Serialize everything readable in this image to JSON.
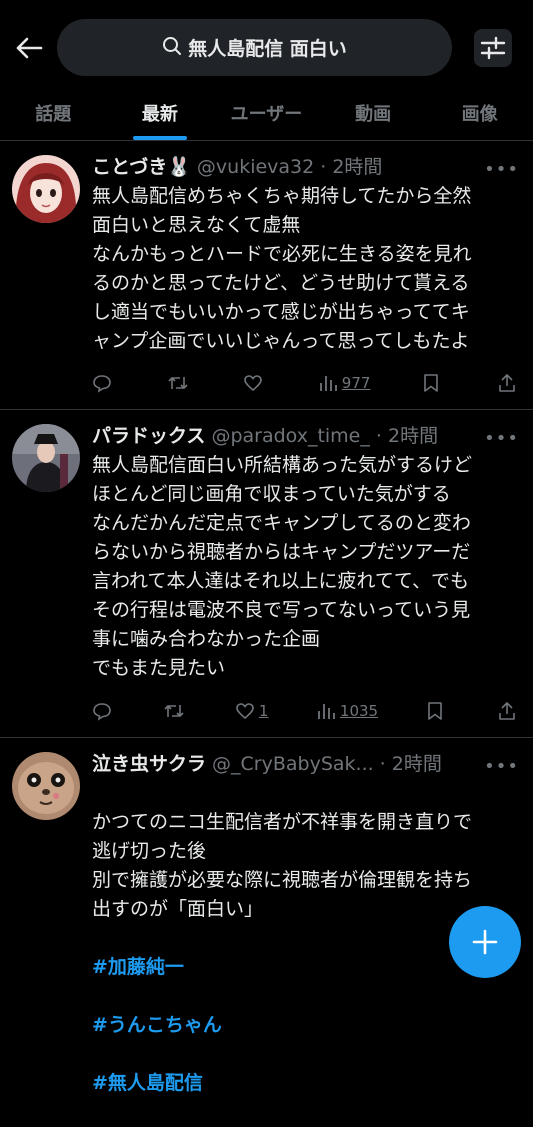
{
  "search": {
    "query": "無人島配信 面白い"
  },
  "tabs": [
    "話題",
    "最新",
    "ユーザー",
    "動画",
    "画像"
  ],
  "active_tab": "最新",
  "tweets": [
    {
      "name": "ことづき🐰",
      "handle": "@vukieva32 · 2時間",
      "text": "無人島配信めちゃくちゃ期待してたから全然\n面白いと思えなくて虚無\nなんかもっとハードで必死に生きる姿を見れ\nるのかと思ってたけど、どうせ助けて貰える\nし適当でもいいかって感じが出ちゃっててキ\nャンプ企画でいいじゃんって思ってしもたよ",
      "likes": "",
      "views": "977"
    },
    {
      "name": "パラドックス",
      "handle": "@paradox_time_ · 2時間",
      "text": "無人島配信面白い所結構あった気がするけど\nほとんど同じ画角で収まっていた気がする\nなんだかんだ定点でキャンプしてるのと変わ\nらないから視聴者からはキャンプだツアーだ\n言われて本人達はそれ以上に疲れてて、でも\nその行程は電波不良で写ってないっていう見\n事に噛み合わなかった企画\nでもまた見たい",
      "likes": "1",
      "views": "1035"
    },
    {
      "name": "泣き虫サクラ",
      "handle": "@_CryBabySak... · 2時間",
      "text": "かつてのニコ生配信者が不祥事を開き直りで\n逃げ切った後\n別で擁護が必要な際に視聴者が倫理観を持ち\n出すのが「面白い」\n",
      "hashtags": [
        "#加藤純一",
        "#うんこちゃん",
        "#無人島配信"
      ]
    }
  ],
  "colors": {
    "accent": "#1d9bf0",
    "secondary_text": "#71767b",
    "divider": "#2f3336"
  }
}
